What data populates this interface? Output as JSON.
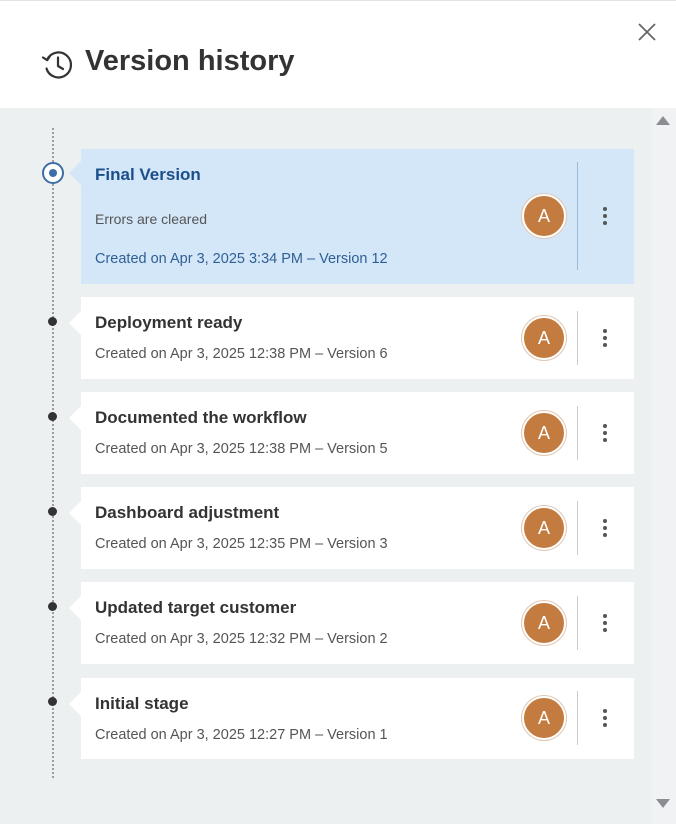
{
  "header": {
    "title": "Version history",
    "history_icon": "history-clock-icon",
    "close_icon": "close-x-icon"
  },
  "colors": {
    "accent": "#3d6ea8",
    "active_card_bg": "#d4e7f9",
    "avatar_bg": "#c47b3f",
    "content_bg": "#edf0f1"
  },
  "versions": [
    {
      "title": "Final Version",
      "description": "Errors are cleared",
      "meta": "Created on Apr 3, 2025 3:34 PM – Version 12",
      "avatar": "A",
      "current": true
    },
    {
      "title": "Deployment ready",
      "meta": "Created on Apr 3, 2025 12:38 PM – Version 6",
      "avatar": "A"
    },
    {
      "title": "Documented the workflow",
      "meta": "Created on Apr 3, 2025 12:38 PM – Version 5",
      "avatar": "A"
    },
    {
      "title": "Dashboard adjustment",
      "meta": "Created on Apr 3, 2025 12:35 PM – Version 3",
      "avatar": "A"
    },
    {
      "title": "Updated target customer",
      "meta": "Created on Apr 3, 2025 12:32 PM – Version 2",
      "avatar": "A"
    },
    {
      "title": "Initial stage",
      "meta": "Created on Apr 3, 2025 12:27 PM – Version 1",
      "avatar": "A"
    }
  ]
}
